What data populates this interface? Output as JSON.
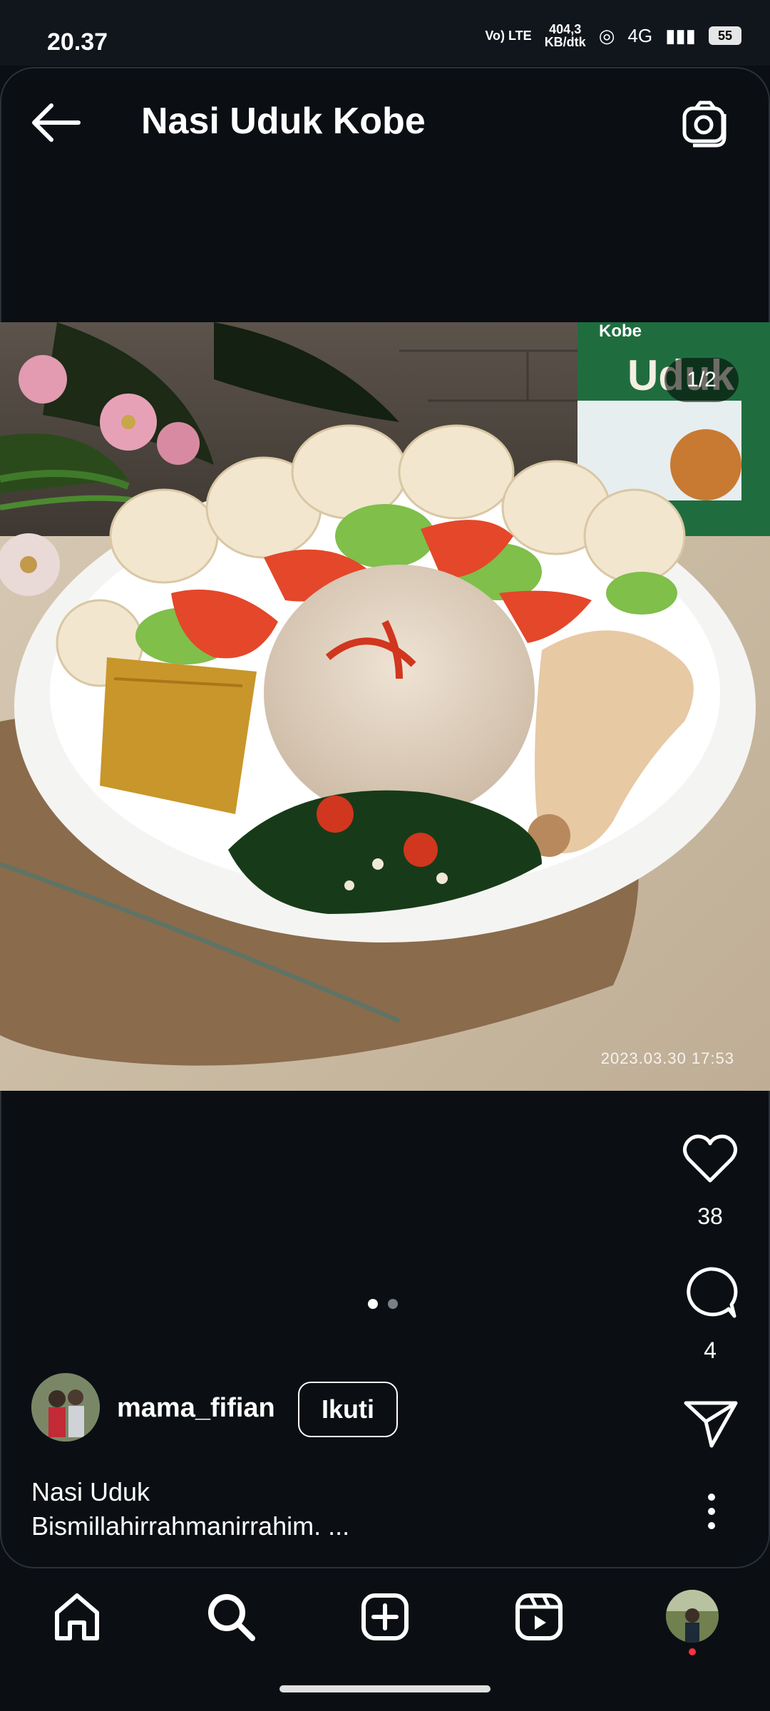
{
  "status_bar": {
    "time": "20.37",
    "network_label": "Vo) LTE",
    "speed_value": "404,3",
    "speed_unit": "KB/dtk",
    "network_type": "4G",
    "battery": "55"
  },
  "header": {
    "title": "Nasi Uduk Kobe",
    "back_icon": "arrow-left-icon",
    "camera_icon": "camera-icon"
  },
  "post": {
    "carousel_counter": "1/2",
    "photo_timestamp": "2023.03.30 17:53",
    "carousel_page": 1,
    "carousel_total": 2,
    "likes": "38",
    "comments": "4",
    "username": "mama_fifian",
    "follow_label": "Ikuti",
    "caption_title": "Nasi Uduk",
    "caption_text": "Bismillahirrahmanirrahim. ..."
  },
  "bottom_nav": {
    "items": [
      "home-icon",
      "search-icon",
      "create-icon",
      "reels-icon",
      "profile-avatar"
    ]
  },
  "colors": {
    "background": "#0b0f14",
    "text": "#ffffff",
    "notification": "#ff3040"
  }
}
